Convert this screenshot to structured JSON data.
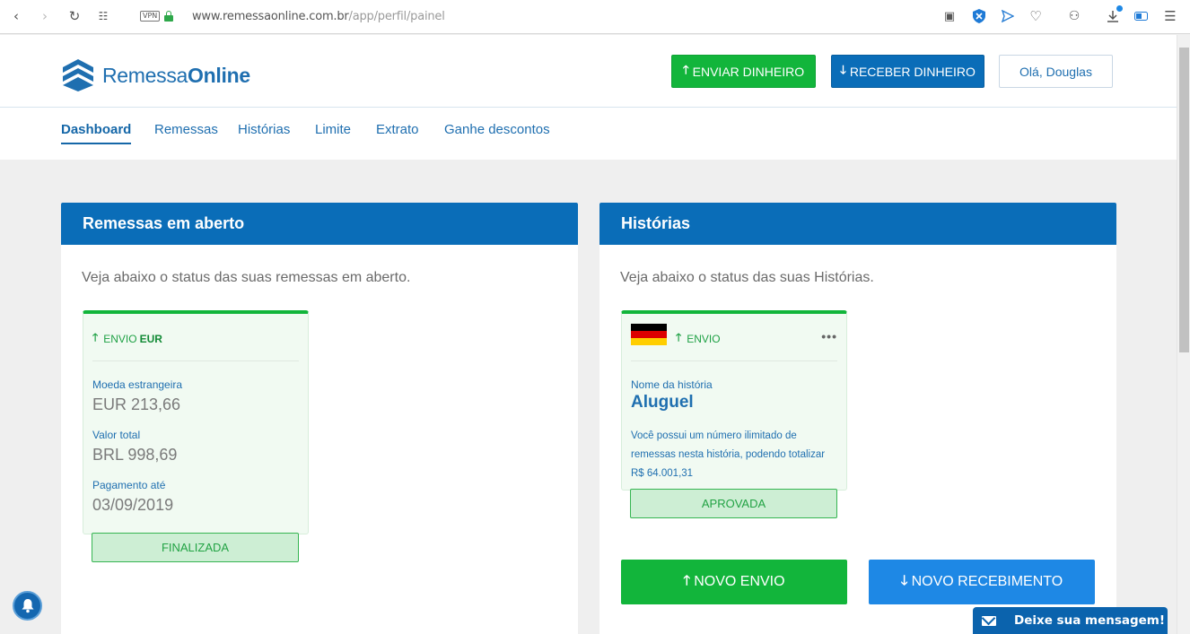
{
  "browser": {
    "vpn_label": "VPN",
    "url_host": "www.remessaonline.com.br",
    "url_path": "/app/perfil/painel"
  },
  "header": {
    "logo_part1": "Remessa",
    "logo_part2": "Online",
    "send_button": "ENVIAR DINHEIRO",
    "receive_button": "RECEBER DINHEIRO",
    "user_button": "Olá, Douglas"
  },
  "nav": {
    "items": [
      {
        "label": "Dashboard"
      },
      {
        "label": "Remessas"
      },
      {
        "label": "Histórias"
      },
      {
        "label": "Limite"
      },
      {
        "label": "Extrato"
      },
      {
        "label": "Ganhe descontos"
      }
    ],
    "active": "Dashboard"
  },
  "open_remittances": {
    "title": "Remessas em aberto",
    "description": "Veja abaixo o status das suas remessas em aberto.",
    "card": {
      "type": "ENVIO",
      "currency": "EUR",
      "foreign_label": "Moeda estrangeira",
      "foreign_value": "EUR 213,66",
      "total_label": "Valor total",
      "total_value": "BRL 998,69",
      "payment_label": "Pagamento até",
      "payment_value": "03/09/2019",
      "status": "FINALIZADA"
    }
  },
  "stories": {
    "title": "Histórias",
    "description": "Veja abaixo o status das suas Histórias.",
    "card": {
      "type": "ENVIO",
      "menu": "•••",
      "name_label": "Nome da história",
      "name_value": "Aluguel",
      "text": "Você possui um número ilimitado de remessas nesta história, podendo totalizar R$ 64.001,31",
      "status": "APROVADA"
    },
    "new_send_button": "NOVO ENVIO",
    "new_receive_button": "NOVO RECEBIMENTO"
  },
  "chat": {
    "label": "Deixe sua mensagem!"
  },
  "colors": {
    "brand_blue": "#0a6db8",
    "brand_green": "#12b53b",
    "receive_blue": "#1e88e5"
  }
}
